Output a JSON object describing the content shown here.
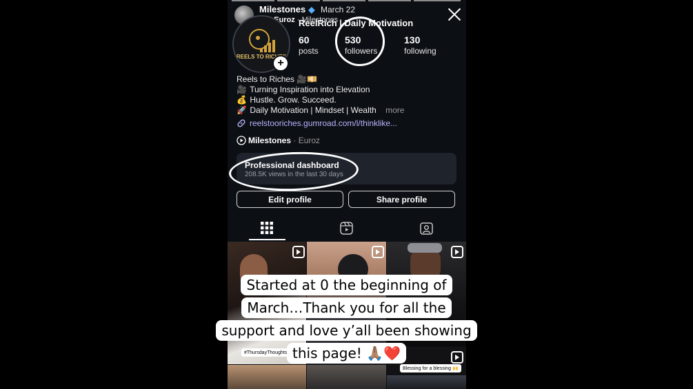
{
  "story": {
    "user": "Milestones",
    "date": "March 22",
    "music_artist": "Euroz",
    "music_title": "Milestones"
  },
  "profile": {
    "display_name": "ReelRich | Daily Motivation",
    "avatar_text": "REELS TO RICHES",
    "stats": {
      "posts": {
        "value": "60",
        "label": "posts"
      },
      "followers": {
        "value": "530",
        "label": "followers"
      },
      "following": {
        "value": "130",
        "label": "following"
      }
    },
    "bio": {
      "name": "Reels to Riches 🎥💴",
      "lines": [
        {
          "icon": "🎥",
          "text": "Turning Inspiration into Elevation"
        },
        {
          "icon": "💰",
          "text": "Hustle. Grow. Succeed."
        },
        {
          "icon": "🚀",
          "text": "Daily Motivation | Mindset | Wealth"
        }
      ],
      "more": "more",
      "link": "reelstooriches.gumroad.com/l/thinklike..."
    },
    "music": {
      "title": "Milestones",
      "artist": "Euroz"
    },
    "dashboard": {
      "title": "Professional dashboard",
      "subtitle": "208.5K views in the last 30 days"
    },
    "buttons": {
      "edit": "Edit profile",
      "share": "Share profile"
    }
  },
  "tabs": [
    {
      "icon": "grid-icon",
      "active": true
    },
    {
      "icon": "reels-icon",
      "active": false
    },
    {
      "icon": "tagged-icon",
      "active": false
    }
  ],
  "grid": {
    "tags": [
      "#ThursdayThoughts 😊",
      "Blessing for a blessing 🙌"
    ]
  },
  "caption": [
    "Started at 0 the beginning of",
    "March…Thank you for all the",
    "support and love y’all been showing",
    "this page! 🙏🏽❤️"
  ],
  "colors": {
    "background": "#0c0f14",
    "link": "#b9b5ff",
    "dashboard": "#1f232b"
  }
}
